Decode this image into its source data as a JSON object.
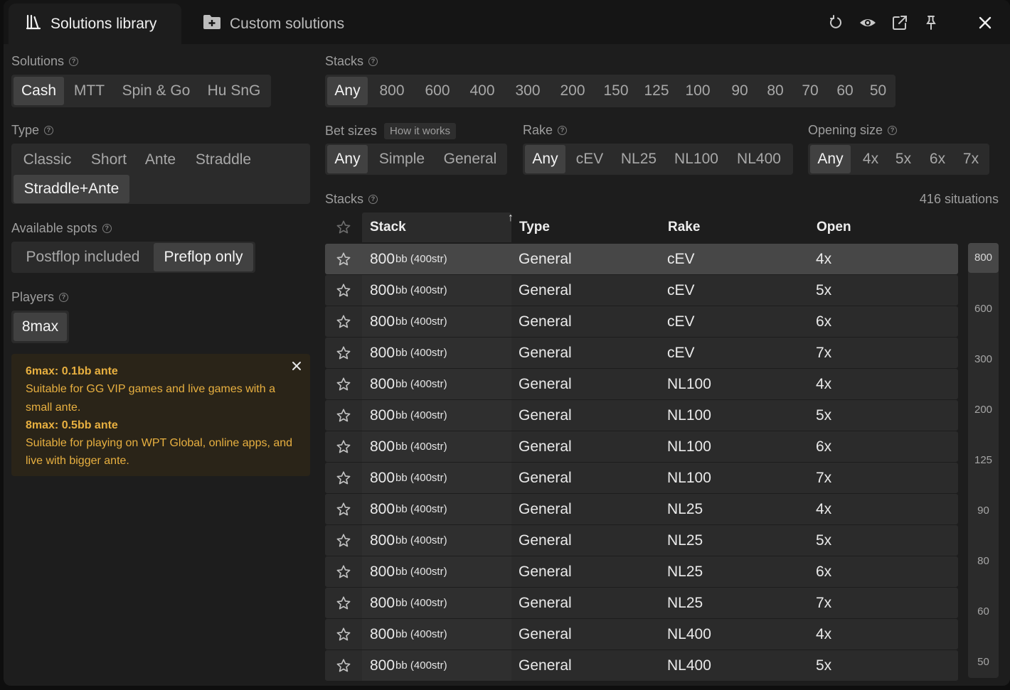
{
  "tabs": [
    {
      "label": "Solutions library",
      "icon": "library-icon",
      "active": true
    },
    {
      "label": "Custom solutions",
      "icon": "folder-plus-icon",
      "active": false
    }
  ],
  "titlebar_icons": [
    "refresh-icon",
    "eye-icon",
    "external-link-icon",
    "pin-icon",
    "close-icon"
  ],
  "filters": {
    "solutions": {
      "label": "Solutions",
      "options": [
        "Cash",
        "MTT",
        "Spin & Go",
        "Hu SnG"
      ],
      "selected": "Cash"
    },
    "type": {
      "label": "Type",
      "options": [
        "Classic",
        "Short",
        "Ante",
        "Straddle",
        "Straddle+Ante"
      ],
      "selected": "Straddle+Ante"
    },
    "available_spots": {
      "label": "Available spots",
      "options": [
        "Postflop included",
        "Preflop only"
      ],
      "selected": "Preflop only"
    },
    "players": {
      "label": "Players",
      "options": [
        "8max"
      ],
      "selected": "8max"
    },
    "stacks": {
      "label": "Stacks",
      "options": [
        "Any",
        "800",
        "600",
        "400",
        "300",
        "200",
        "150",
        "125",
        "100",
        "90",
        "80",
        "70",
        "60",
        "50"
      ],
      "selected": "Any"
    },
    "bet_sizes": {
      "label": "Bet sizes",
      "badge": "How it works",
      "options": [
        "Any",
        "Simple",
        "General"
      ],
      "selected": "Any"
    },
    "rake": {
      "label": "Rake",
      "options": [
        "Any",
        "cEV",
        "NL25",
        "NL100",
        "NL400"
      ],
      "selected": "Any"
    },
    "opening_size": {
      "label": "Opening size",
      "options": [
        "Any",
        "4x",
        "5x",
        "6x",
        "7x"
      ],
      "selected": "Any"
    }
  },
  "notice": {
    "title1": "6max: 0.1bb ante",
    "text1": "Suitable for GG VIP games and live games with a small ante.",
    "title2": "8max: 0.5bb ante",
    "text2": "Suitable for playing on WPT Global, online apps, and live with bigger ante."
  },
  "table": {
    "section_label": "Stacks",
    "count": "416 situations",
    "columns": [
      "Stack",
      "Type",
      "Rake",
      "Open"
    ],
    "sort_indicator": "↑",
    "rows": [
      {
        "stack": "800",
        "unit": "bb (400str)",
        "type": "General",
        "rake": "cEV",
        "open": "4x",
        "highlight": true
      },
      {
        "stack": "800",
        "unit": "bb (400str)",
        "type": "General",
        "rake": "cEV",
        "open": "5x"
      },
      {
        "stack": "800",
        "unit": "bb (400str)",
        "type": "General",
        "rake": "cEV",
        "open": "6x"
      },
      {
        "stack": "800",
        "unit": "bb (400str)",
        "type": "General",
        "rake": "cEV",
        "open": "7x"
      },
      {
        "stack": "800",
        "unit": "bb (400str)",
        "type": "General",
        "rake": "NL100",
        "open": "4x"
      },
      {
        "stack": "800",
        "unit": "bb (400str)",
        "type": "General",
        "rake": "NL100",
        "open": "5x"
      },
      {
        "stack": "800",
        "unit": "bb (400str)",
        "type": "General",
        "rake": "NL100",
        "open": "6x"
      },
      {
        "stack": "800",
        "unit": "bb (400str)",
        "type": "General",
        "rake": "NL100",
        "open": "7x"
      },
      {
        "stack": "800",
        "unit": "bb (400str)",
        "type": "General",
        "rake": "NL25",
        "open": "4x"
      },
      {
        "stack": "800",
        "unit": "bb (400str)",
        "type": "General",
        "rake": "NL25",
        "open": "5x"
      },
      {
        "stack": "800",
        "unit": "bb (400str)",
        "type": "General",
        "rake": "NL25",
        "open": "6x"
      },
      {
        "stack": "800",
        "unit": "bb (400str)",
        "type": "General",
        "rake": "NL25",
        "open": "7x"
      },
      {
        "stack": "800",
        "unit": "bb (400str)",
        "type": "General",
        "rake": "NL400",
        "open": "4x"
      },
      {
        "stack": "800",
        "unit": "bb (400str)",
        "type": "General",
        "rake": "NL400",
        "open": "5x"
      }
    ]
  },
  "scroll_index": [
    "800",
    "600",
    "300",
    "200",
    "125",
    "90",
    "80",
    "60",
    "50"
  ],
  "colors": {
    "background": "#1d1d1d",
    "titlebar": "#151515",
    "segment": "#2b2b2b",
    "selected": "#414141",
    "notice_bg": "#2a2418",
    "notice_text": "#e8b040"
  }
}
